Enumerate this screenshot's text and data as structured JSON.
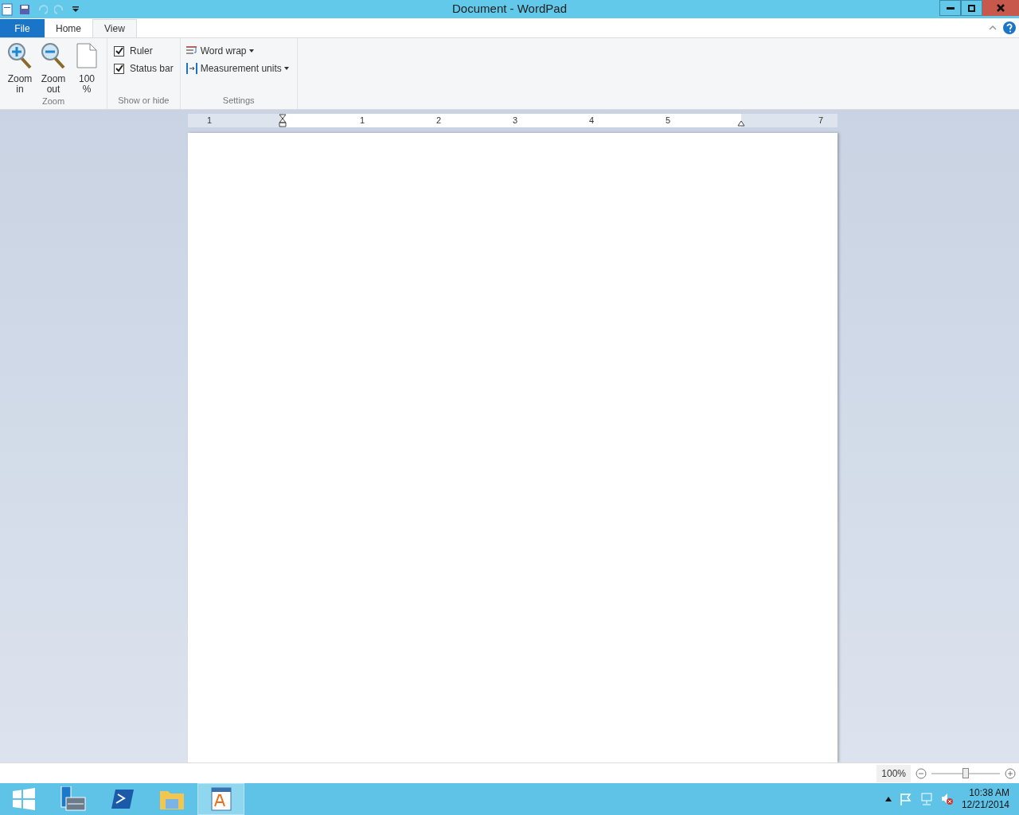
{
  "window": {
    "title": "Document - WordPad"
  },
  "tabs": [
    {
      "label": "File",
      "kind": "file",
      "selected": false
    },
    {
      "label": "Home",
      "kind": "tab",
      "selected": false
    },
    {
      "label": "View",
      "kind": "tab",
      "selected": true
    }
  ],
  "ribbon": {
    "groups": [
      {
        "label": "Zoom",
        "kind": "zoom",
        "items": [
          {
            "label": "Zoom in",
            "kind": "zoom-in"
          },
          {
            "label": "Zoom out",
            "kind": "zoom-out"
          },
          {
            "label": "100 %",
            "kind": "page"
          }
        ]
      },
      {
        "label": "Show or hide",
        "kind": "checks",
        "items": [
          {
            "label": "Ruler",
            "checked": true
          },
          {
            "label": "Status bar",
            "checked": true
          }
        ]
      },
      {
        "label": "Settings",
        "kind": "settings",
        "items": [
          {
            "label": "Word wrap",
            "kind": "wrap"
          },
          {
            "label": "Measurement units",
            "kind": "units"
          }
        ]
      }
    ]
  },
  "ruler": {
    "labels": [
      "1",
      "1",
      "2",
      "3",
      "4",
      "5",
      "7"
    ]
  },
  "status_bar": {
    "zoom": "100%",
    "level": 0.5
  },
  "taskbar": {
    "apps": [
      {
        "kind": "start",
        "selected": false
      },
      {
        "kind": "server",
        "selected": false
      },
      {
        "kind": "shell",
        "selected": false
      },
      {
        "kind": "folder",
        "selected": false
      },
      {
        "kind": "wordpad",
        "selected": true
      }
    ],
    "time": "10:38 AM",
    "date": "12/21/2014"
  }
}
